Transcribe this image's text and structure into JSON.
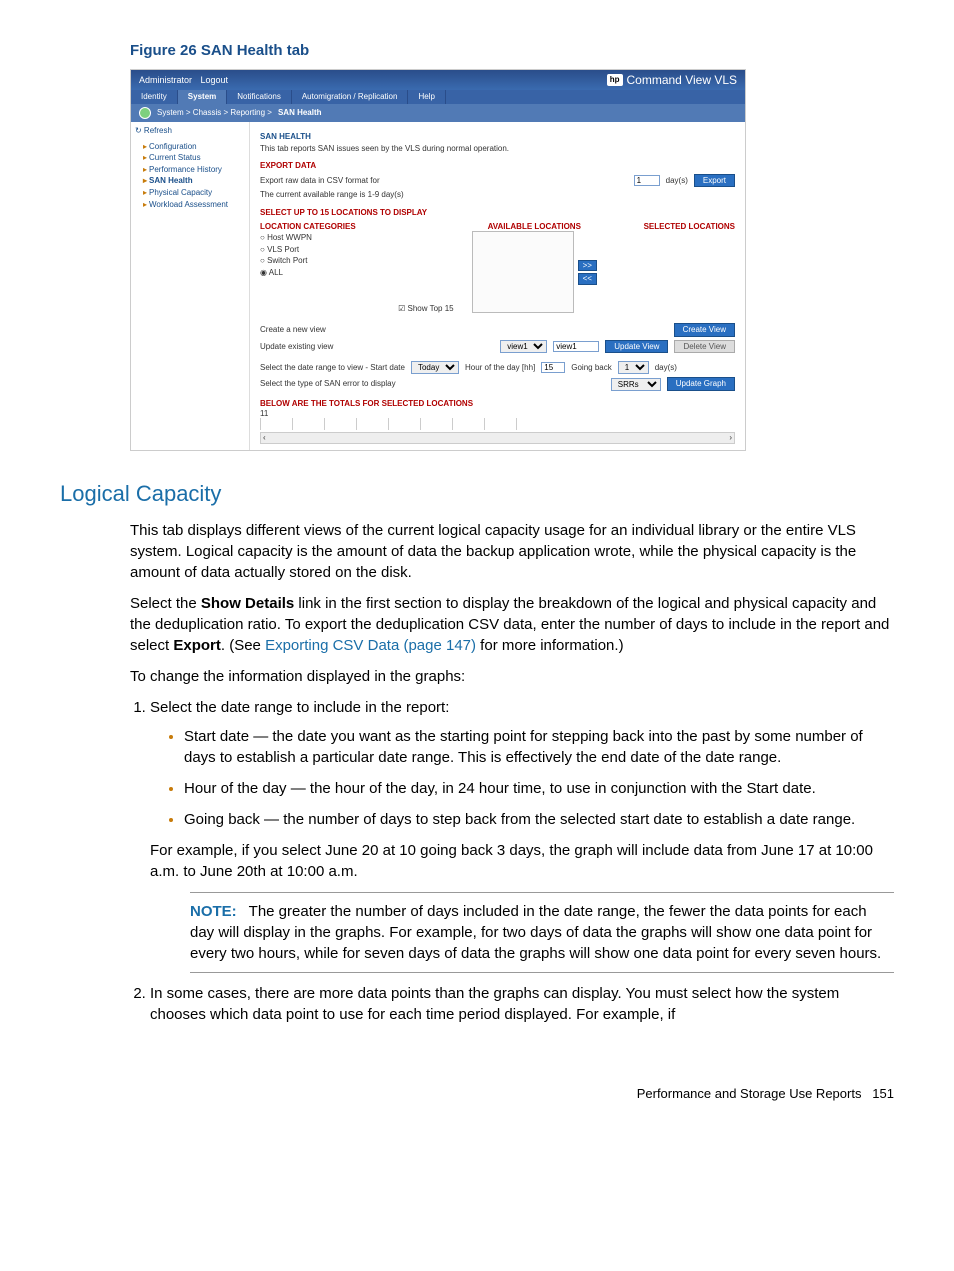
{
  "figure_title": "Figure 26 SAN Health tab",
  "screenshot": {
    "header": {
      "admin": "Administrator",
      "logout": "Logout",
      "brand": "Command View VLS",
      "hp": "hp"
    },
    "tabs": [
      "Identity",
      "System",
      "Notifications",
      "Automigration / Replication",
      "Help"
    ],
    "active_tab": "System",
    "breadcrumb": "System > Chassis > Reporting > ",
    "breadcrumb_current": "SAN Health",
    "side": {
      "refresh": "↻ Refresh",
      "items": [
        "Configuration",
        "Current Status",
        "Performance History",
        "SAN Health",
        "Physical Capacity",
        "Workload Assessment"
      ],
      "selected": "SAN Health"
    },
    "main": {
      "title": "SAN HEALTH",
      "desc": "This tab reports SAN issues seen by the VLS during normal operation.",
      "export_title": "EXPORT DATA",
      "export_label": "Export raw data in CSV format for",
      "export_days_value": "1",
      "export_days_unit": "day(s)",
      "export_btn": "Export",
      "export_range": "The current available range is 1-9 day(s)",
      "select_header": "SELECT UP TO 15 LOCATIONS TO DISPLAY",
      "loc_cat": "LOCATION CATEGORIES",
      "avail_loc": "AVAILABLE LOCATIONS",
      "sel_loc": "SELECTED LOCATIONS",
      "radios": [
        "Host WWPN",
        "VLS Port",
        "Switch Port",
        "ALL"
      ],
      "show_top": "Show Top 15",
      "move_right": ">>",
      "move_left": "<<",
      "create_label": "Create a new view",
      "create_btn": "Create View",
      "update_label": "Update existing view",
      "view_sel": "view1",
      "view_text": "view1",
      "update_btn": "Update View",
      "delete_btn": "Delete View",
      "range_label": "Select the date range to view  -  Start date",
      "start_date": "Today",
      "hour_label": "Hour of the day [hh]",
      "hour_val": "15",
      "going_back": "Going back",
      "back_val": "1",
      "back_unit": "day(s)",
      "err_label": "Select the type of SAN error to display",
      "err_sel": "SRRs",
      "update_graph": "Update Graph",
      "totals": "BELOW ARE THE TOTALS FOR SELECTED LOCATIONS",
      "y_tick": "11"
    }
  },
  "section_heading": "Logical Capacity",
  "para1": "This tab displays different views of the current logical capacity usage for an individual library or the entire VLS system. Logical capacity is the amount of data the backup application wrote, while the physical capacity is the amount of data actually stored on the disk.",
  "para2_a": "Select the ",
  "para2_b": "Show Details",
  "para2_c": " link in the first section to display the breakdown of the logical and physical capacity and the deduplication ratio. To export the deduplication CSV data, enter the number of days to include in the report and select ",
  "para2_d": "Export",
  "para2_e": ". (See ",
  "para2_link": "Exporting CSV Data (page 147)",
  "para2_f": " for more information.)",
  "para3": "To change the information displayed in the graphs:",
  "li1_intro": "Select the date range to include in the report:",
  "bullet1": "Start date — the date you want as the starting point for stepping back into the past by some number of days to establish a particular date range. This is effectively the end date of the date range.",
  "bullet2": "Hour of the day — the hour of the day, in 24 hour time, to use in conjunction with the Start date.",
  "bullet3": "Going back — the number of days to step back from the selected start date to establish a date range.",
  "example": "For example, if you select June 20 at 10 going back 3 days, the graph will include data from June 17 at 10:00 a.m. to June 20th at 10:00 a.m.",
  "note_label": "NOTE:",
  "note_text": "The greater the number of days included in the date range, the fewer the data points for each day will display in the graphs. For example, for two days of data the graphs will show one data point for every two hours, while for seven days of data the graphs will show one data point for every seven hours.",
  "li2": "In some cases, there are more data points than the graphs can display. You must select how the system chooses which data point to use for each time period displayed. For example, if",
  "footer_text": "Performance and Storage Use Reports",
  "footer_page": "151"
}
